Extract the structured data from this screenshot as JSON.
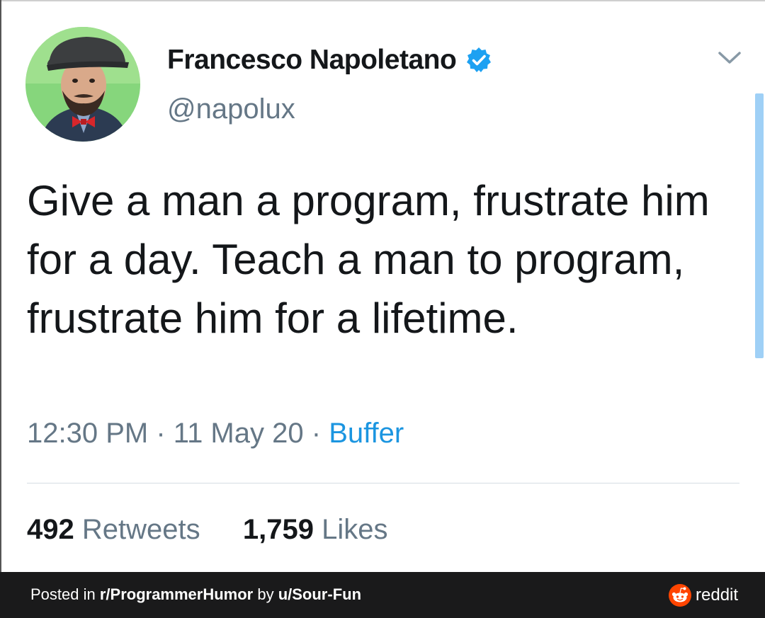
{
  "tweet": {
    "author": {
      "display_name": "Francesco Napoletano",
      "handle": "@napolux",
      "verified": true
    },
    "text": "Give a man a program, frustrate him for a day. Teach a man to program, frustrate him for a lifetime.",
    "time": "12:30 PM",
    "separator": "·",
    "date": "11 May 20",
    "source": "Buffer",
    "retweets_count": "492",
    "retweets_label": "Retweets",
    "likes_count": "1,759",
    "likes_label": "Likes"
  },
  "footer": {
    "posted_in_prefix": "Posted in ",
    "subreddit": "r/ProgrammerHumor",
    "by_text": " by ",
    "user": "u/Sour-Fun",
    "brand": "reddit"
  },
  "icons": {
    "verified": "verified-badge-icon",
    "menu": "chevron-down-icon",
    "brand_logo": "reddit-logo-icon"
  },
  "colors": {
    "verified_blue": "#1da1f2",
    "link_blue": "#1b95e0",
    "secondary_text": "#657786",
    "footer_bg": "#1a1a1b",
    "reddit_orange": "#ff4500"
  }
}
